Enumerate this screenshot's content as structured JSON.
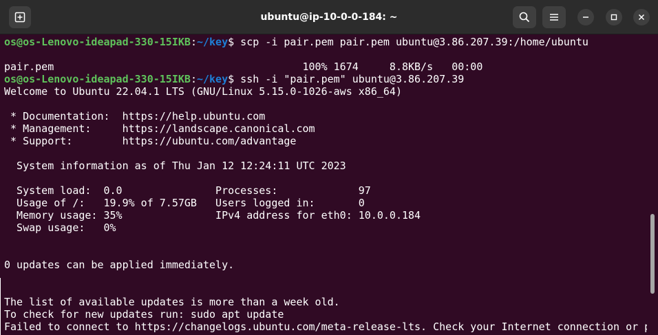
{
  "window": {
    "title": "ubuntu@ip-10-0-0-184: ~",
    "icons": {
      "new_tab": "new-tab-icon",
      "search": "search-icon",
      "menu": "hamburger-menu-icon",
      "minimize": "minimize-icon",
      "maximize": "maximize-icon",
      "close": "close-icon"
    }
  },
  "colors": {
    "background": "#300a24",
    "prompt_user": "#5fc35b",
    "prompt_path": "#1e7fd6",
    "text": "#ffffff"
  },
  "terminal": {
    "cmd1": {
      "user": "os@os-Lenovo-ideapad-330-15IKB",
      "sep": ":",
      "path": "~/key",
      "cmd": "$ scp -i pair.pem pair.pem ubuntu@3.86.207.39:/home/ubuntu"
    },
    "transfer": "pair.pem                                        100% 1674     8.8KB/s   00:00",
    "cmd2": {
      "user": "os@os-Lenovo-ideapad-330-15IKB",
      "sep": ":",
      "path": "~/key",
      "cmd": "$ ssh -i \"pair.pem\" ubuntu@3.86.207.39"
    },
    "welcome": "Welcome to Ubuntu 22.04.1 LTS (GNU/Linux 5.15.0-1026-aws x86_64)",
    "docs": " * Documentation:  https://help.ubuntu.com",
    "mgmt": " * Management:     https://landscape.canonical.com",
    "support": " * Support:        https://ubuntu.com/advantage",
    "sysinfo": "  System information as of Thu Jan 12 12:24:11 UTC 2023",
    "sys1": "  System load:  0.0               Processes:             97",
    "sys2": "  Usage of /:   19.9% of 7.57GB   Users logged in:       0",
    "sys3": "  Memory usage: 35%               IPv4 address for eth0: 10.0.0.184",
    "sys4": "  Swap usage:   0%",
    "updates": "0 updates can be applied immediately.",
    "old": "The list of available updates is more than a week old.",
    "check": "To check for new updates run: sudo apt update",
    "failed": "Failed to connect to https://changelogs.ubuntu.com/meta-release-lts. Check your Internet connection or p"
  }
}
